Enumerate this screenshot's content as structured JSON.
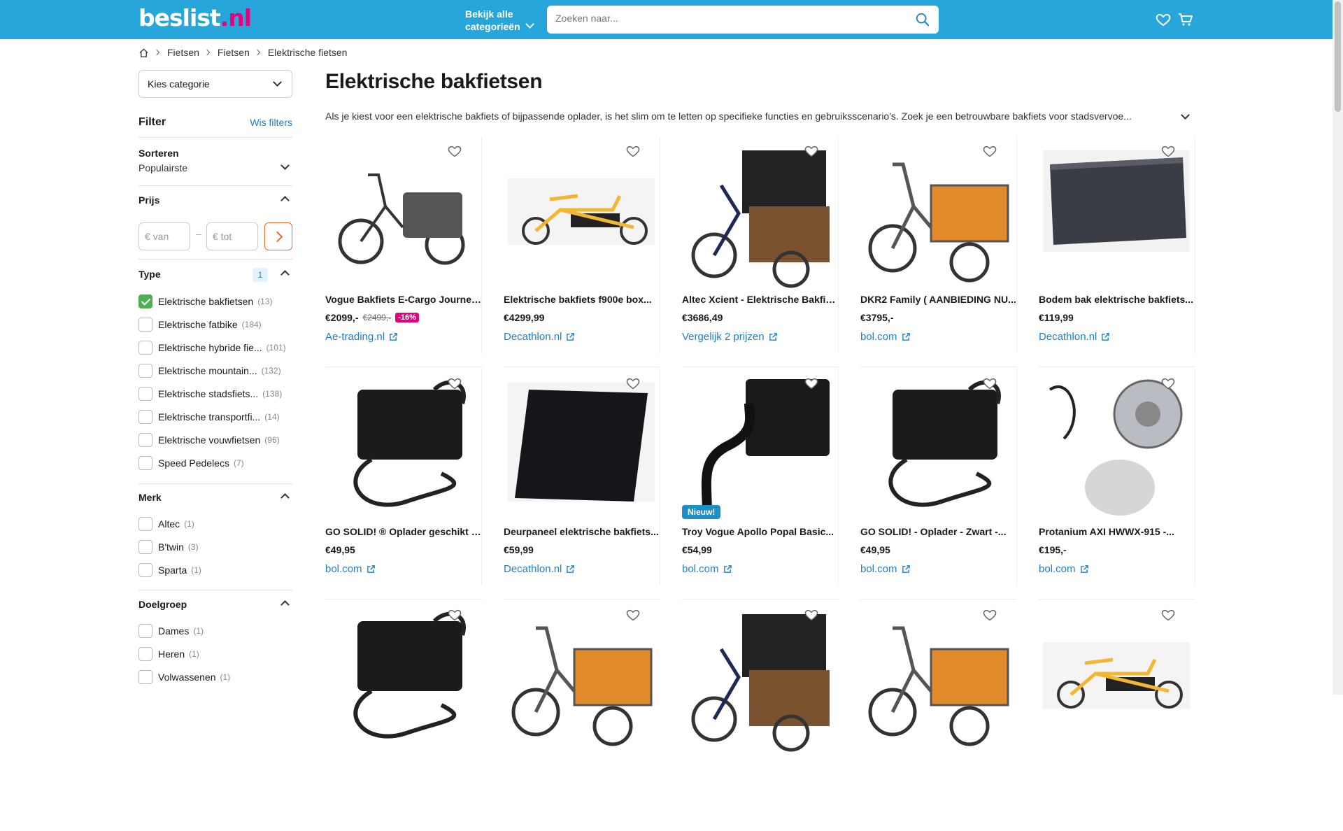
{
  "header": {
    "logo_main": "beslist",
    "logo_dot": ".",
    "logo_tld": "nl",
    "categories_line1": "Bekijk alle",
    "categories_line2": "categorieën",
    "search_placeholder": "Zoeken naar..."
  },
  "breadcrumb": [
    "Fietsen",
    "Fietsen",
    "Elektrische fietsen"
  ],
  "sidebar": {
    "category_select": "Kies categorie",
    "filter_title": "Filter",
    "clear_filters": "Wis filters",
    "sort_title": "Sorteren",
    "sort_value": "Populairste",
    "price_title": "Prijs",
    "price_from": "€  van",
    "price_to": "€  tot",
    "price_dash": "–",
    "type_title": "Type",
    "type_count": "1",
    "type_items": [
      {
        "label": "Elektrische bakfietsen",
        "count": "(13)",
        "checked": true
      },
      {
        "label": "Elektrische fatbike",
        "count": "(184)",
        "checked": false
      },
      {
        "label": "Elektrische hybride fie...",
        "count": "(101)",
        "checked": false
      },
      {
        "label": "Elektrische mountain...",
        "count": "(132)",
        "checked": false
      },
      {
        "label": "Elektrische stadsfiets...",
        "count": "(138)",
        "checked": false
      },
      {
        "label": "Elektrische transportfi...",
        "count": "(14)",
        "checked": false
      },
      {
        "label": "Elektrische vouwfietsen",
        "count": "(96)",
        "checked": false
      },
      {
        "label": "Speed Pedelecs",
        "count": "(7)",
        "checked": false
      }
    ],
    "brand_title": "Merk",
    "brand_items": [
      {
        "label": "Altec",
        "count": "(1)"
      },
      {
        "label": "B'twin",
        "count": "(3)"
      },
      {
        "label": "Sparta",
        "count": "(1)"
      }
    ],
    "audience_title": "Doelgroep",
    "audience_items": [
      {
        "label": "Dames",
        "count": "(1)"
      },
      {
        "label": "Heren",
        "count": "(1)"
      },
      {
        "label": "Volwassenen",
        "count": "(1)"
      }
    ]
  },
  "main": {
    "title": "Elektrische bakfietsen",
    "intro": "Als je kiest voor een elektrische bakfiets of bijpassende oplader, is het slim om te letten op specifieke functies en gebruiksscenario's. Zoek je een betrouwbare bakfiets voor stadsvervoe...",
    "products": [
      {
        "name": "Vogue Bakfiets E-Cargo Journey-...",
        "price": "€2099,-",
        "old_price": "€2499,-",
        "discount": "-16%",
        "shop": "Ae-trading.nl",
        "new": ""
      },
      {
        "name": "Elektrische bakfiets f900e box...",
        "price": "€4299,99",
        "old_price": "",
        "discount": "",
        "shop": "Decathlon.nl",
        "new": ""
      },
      {
        "name": "Altec Xcient - Elektrische Bakfiet...",
        "price": "€3686,49",
        "old_price": "",
        "discount": "",
        "shop": "Vergelijk 2 prijzen",
        "new": ""
      },
      {
        "name": "DKR2 Family ( AANBIEDING NU...",
        "price": "€3795,-",
        "old_price": "",
        "discount": "",
        "shop": "bol.com",
        "new": ""
      },
      {
        "name": "Bodem bak elektrische bakfiets...",
        "price": "€119,99",
        "old_price": "",
        "discount": "",
        "shop": "Decathlon.nl",
        "new": ""
      },
      {
        "name": "GO SOLID! ® Oplader geschikt vo...",
        "price": "€49,95",
        "old_price": "",
        "discount": "",
        "shop": "bol.com",
        "new": ""
      },
      {
        "name": "Deurpaneel elektrische bakfiets...",
        "price": "€59,99",
        "old_price": "",
        "discount": "",
        "shop": "Decathlon.nl",
        "new": ""
      },
      {
        "name": "Troy Vogue Apollo Popal Basic...",
        "price": "€54,99",
        "old_price": "",
        "discount": "",
        "shop": "bol.com",
        "new": "Nieuw!"
      },
      {
        "name": "GO SOLID! - Oplader - Zwart -...",
        "price": "€49,95",
        "old_price": "",
        "discount": "",
        "shop": "bol.com",
        "new": ""
      },
      {
        "name": "Protanium AXI HWWX-915 -...",
        "price": "€195,-",
        "old_price": "",
        "discount": "",
        "shop": "bol.com",
        "new": ""
      }
    ]
  },
  "colors": {
    "brand": "#27a6dc",
    "accent": "#e6007e",
    "link": "#1f7fc7",
    "cta": "#f26522",
    "check": "#4caf50"
  }
}
